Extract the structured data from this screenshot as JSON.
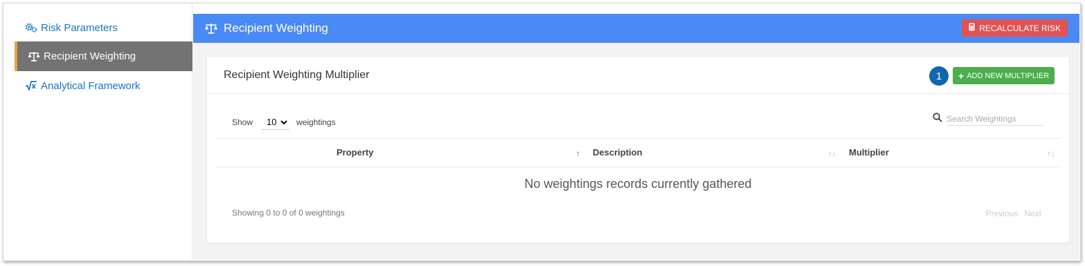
{
  "sidebar": {
    "items": [
      {
        "label": "Risk Parameters",
        "icon": "gears-icon"
      },
      {
        "label": "Recipient Weighting",
        "icon": "balance-scale-icon",
        "active": true
      },
      {
        "label": "Analytical Framework",
        "icon": "square-root-icon"
      }
    ]
  },
  "header": {
    "title": "Recipient Weighting",
    "icon": "balance-scale-icon",
    "recalc_label": "RECALCULATE RISK",
    "recalc_icon": "calculator-icon"
  },
  "card": {
    "title": "Recipient Weighting Multiplier",
    "step_badge": "1",
    "add_label": "ADD NEW MULTIPLIER"
  },
  "table": {
    "show_label": "Show",
    "page_size": "10",
    "page_size_options": [
      "10"
    ],
    "suffix_label": "weightings",
    "search_placeholder": "Search Weightings",
    "columns": [
      "Property",
      "Description",
      "Multiplier"
    ],
    "empty_message": "No weightings records currently gathered",
    "info": "Showing 0 to 0 of 0 weightings",
    "prev_label": "Previous",
    "next_label": "Next"
  },
  "colors": {
    "header": "#4a8af4",
    "active_sidebar": "#737373",
    "accent_bar": "#e8a33d",
    "danger": "#e15353",
    "success": "#4cae4c",
    "badge": "#0f67b1",
    "link": "#1a73c7"
  }
}
